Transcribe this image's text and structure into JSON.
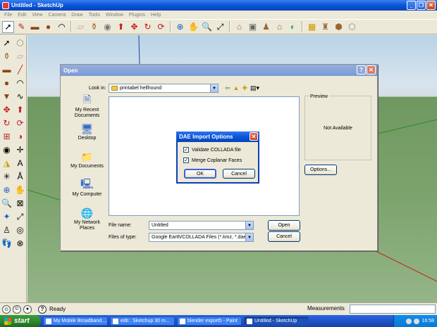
{
  "window": {
    "title": "Untitled - SketchUp"
  },
  "menu": [
    "File",
    "Edit",
    "View",
    "Camera",
    "Draw",
    "Tools",
    "Window",
    "Plugins",
    "Help"
  ],
  "toolbar_icons": [
    "select-icon",
    "pencil-icon",
    "rectangle-icon",
    "circle-icon",
    "arc-icon",
    "eraser-icon",
    "paint-bucket-icon",
    "tape-measure-icon",
    "push-pull-icon",
    "move-icon",
    "rotate-icon",
    "follow-me-icon",
    "orbit-icon",
    "pan-icon",
    "zoom-icon",
    "zoom-extents-icon",
    "walkthrough-icon",
    "look-around-icon",
    "position-camera-icon",
    "3d-warehouse-icon",
    "components-icon",
    "share-model-icon",
    "google-earth-icon"
  ],
  "open_dialog": {
    "title": "Open",
    "look_in_label": "Look in:",
    "look_in_value": "printabel hellhound",
    "places": [
      "My Recent Documents",
      "Desktop",
      "My Documents",
      "My Computer",
      "My Network Places"
    ],
    "preview_label": "Preview",
    "preview_text": "Not Available",
    "options_label": "Options...",
    "file_name_label": "File name:",
    "file_name_value": "Untitled",
    "files_of_type_label": "Files of type:",
    "files_of_type_value": "Google Earth/COLLADA Files (*.kmz, *.dae)",
    "open_label": "Open",
    "cancel_label": "Cancel"
  },
  "dae_dialog": {
    "title": "DAE Import Options",
    "validate_label": "Validate COLLADA file",
    "merge_label": "Merge Coplanar Faces",
    "validate_checked": true,
    "merge_checked": true,
    "ok_label": "OK",
    "cancel_label": "Cancel"
  },
  "status": {
    "ready": "Ready",
    "measurements": "Measurements"
  },
  "taskbar": {
    "start": "start",
    "tasks": [
      "My Mobile Broadband....",
      "edit : Sketchup 30 m...",
      "blender export5 - Paint",
      "Untitled - SketchUp"
    ],
    "clock": "16:58"
  }
}
